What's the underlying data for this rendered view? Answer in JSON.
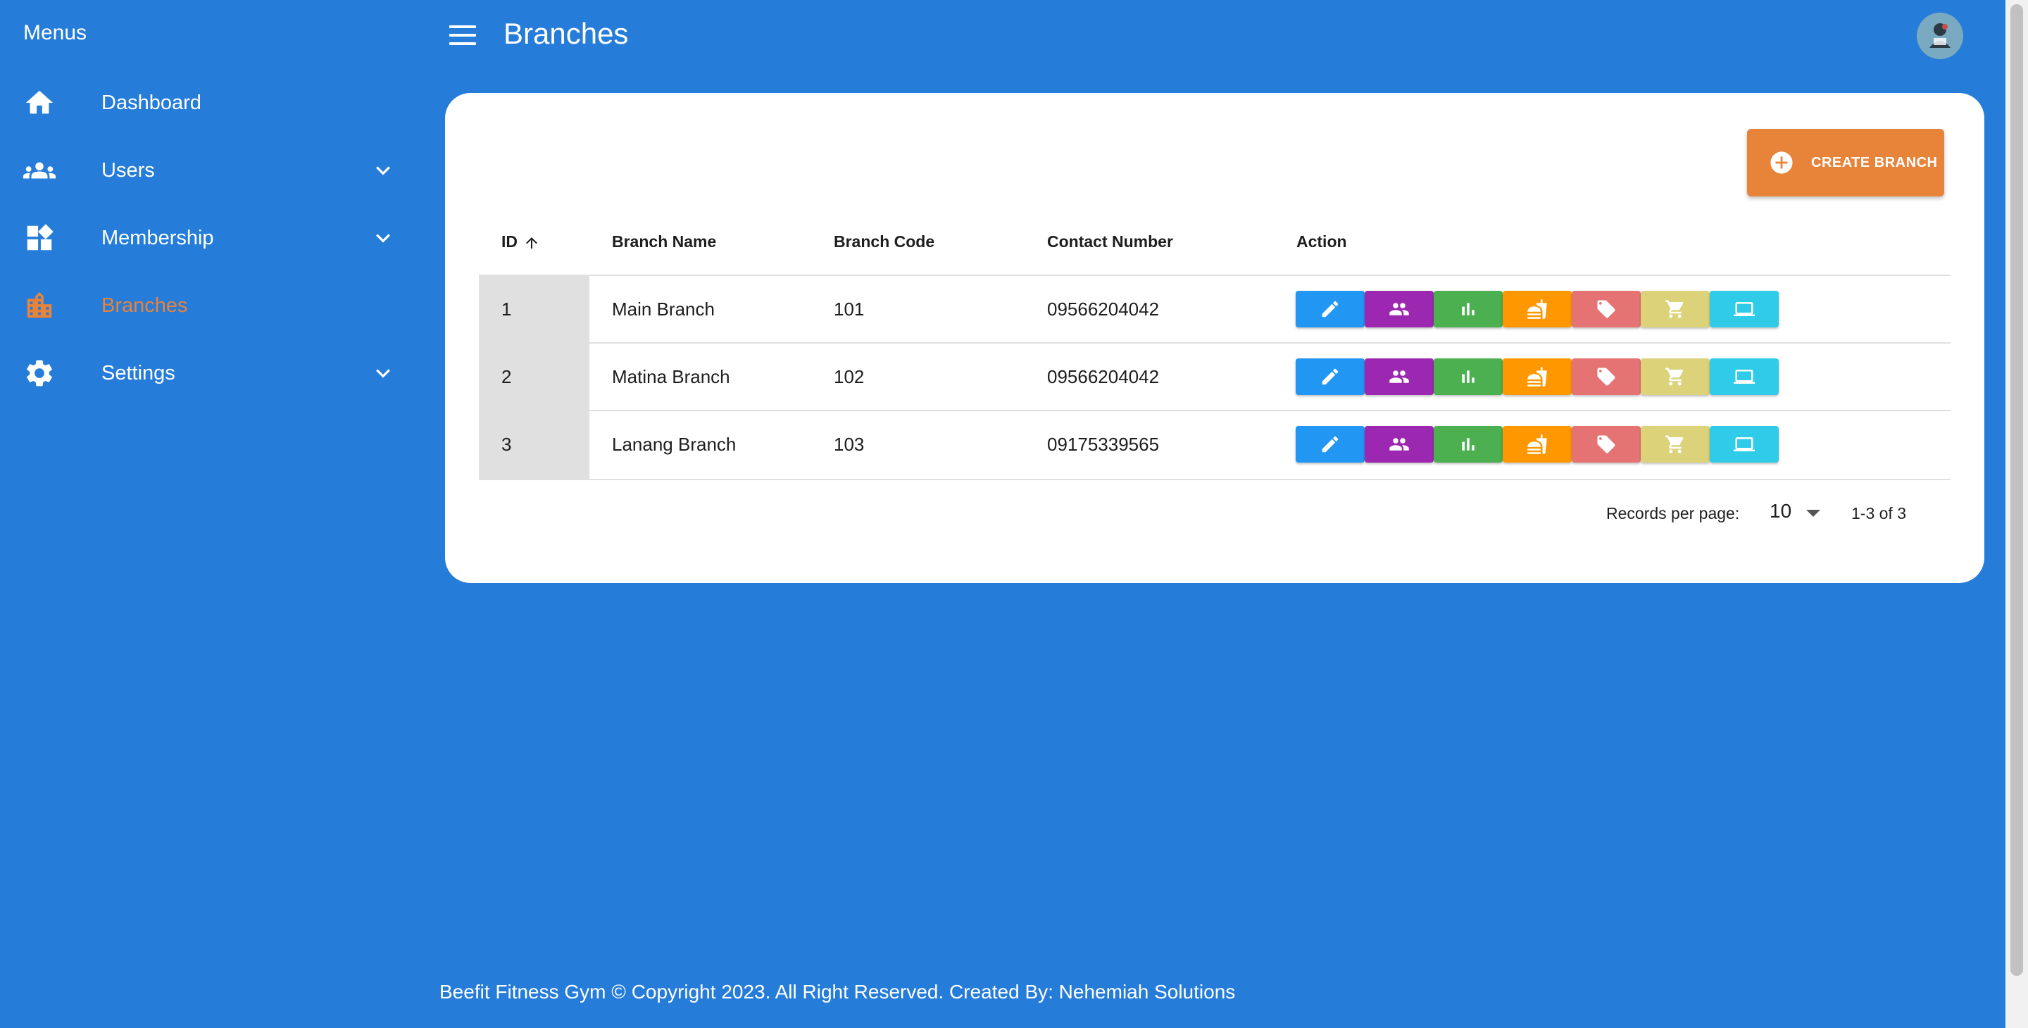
{
  "sidebar": {
    "title": "Menus",
    "items": [
      {
        "label": "Dashboard",
        "icon": "home-icon"
      },
      {
        "label": "Users",
        "icon": "users-icon"
      },
      {
        "label": "Membership",
        "icon": "dashboard-widgets-icon"
      },
      {
        "label": "Branches",
        "icon": "building-icon",
        "active": true
      },
      {
        "label": "Settings",
        "icon": "gear-icon"
      }
    ]
  },
  "header": {
    "title": "Branches"
  },
  "toolbar": {
    "create_label": "CREATE BRANCH"
  },
  "table": {
    "columns": [
      "ID",
      "Branch Name",
      "Branch Code",
      "Contact Number",
      "Action"
    ],
    "rows": [
      {
        "id": "1",
        "name": "Main Branch",
        "code": "101",
        "contact": "09566204042"
      },
      {
        "id": "2",
        "name": "Matina Branch",
        "code": "102",
        "contact": "09566204042"
      },
      {
        "id": "3",
        "name": "Lanang Branch",
        "code": "103",
        "contact": "09175339565"
      }
    ],
    "action_buttons": [
      {
        "icon": "pencil-icon",
        "color": "#2196f3"
      },
      {
        "icon": "people-icon",
        "color": "#9c27b0"
      },
      {
        "icon": "bar-chart-icon",
        "color": "#4caf50"
      },
      {
        "icon": "food-icon",
        "color": "#ff9800"
      },
      {
        "icon": "tag-icon",
        "color": "#e57373"
      },
      {
        "icon": "cart-icon",
        "color": "#dcd27a"
      },
      {
        "icon": "monitor-icon",
        "color": "#2fcbe8"
      }
    ]
  },
  "pagination": {
    "label": "Records per page:",
    "per_page": "10",
    "range": "1-3 of 3"
  },
  "footer": {
    "text": "Beefit Fitness Gym © Copyright 2023. All Right Reserved. Created By: Nehemiah Solutions"
  },
  "colors": {
    "background": "#257cd9",
    "accent": "#e8833a"
  }
}
